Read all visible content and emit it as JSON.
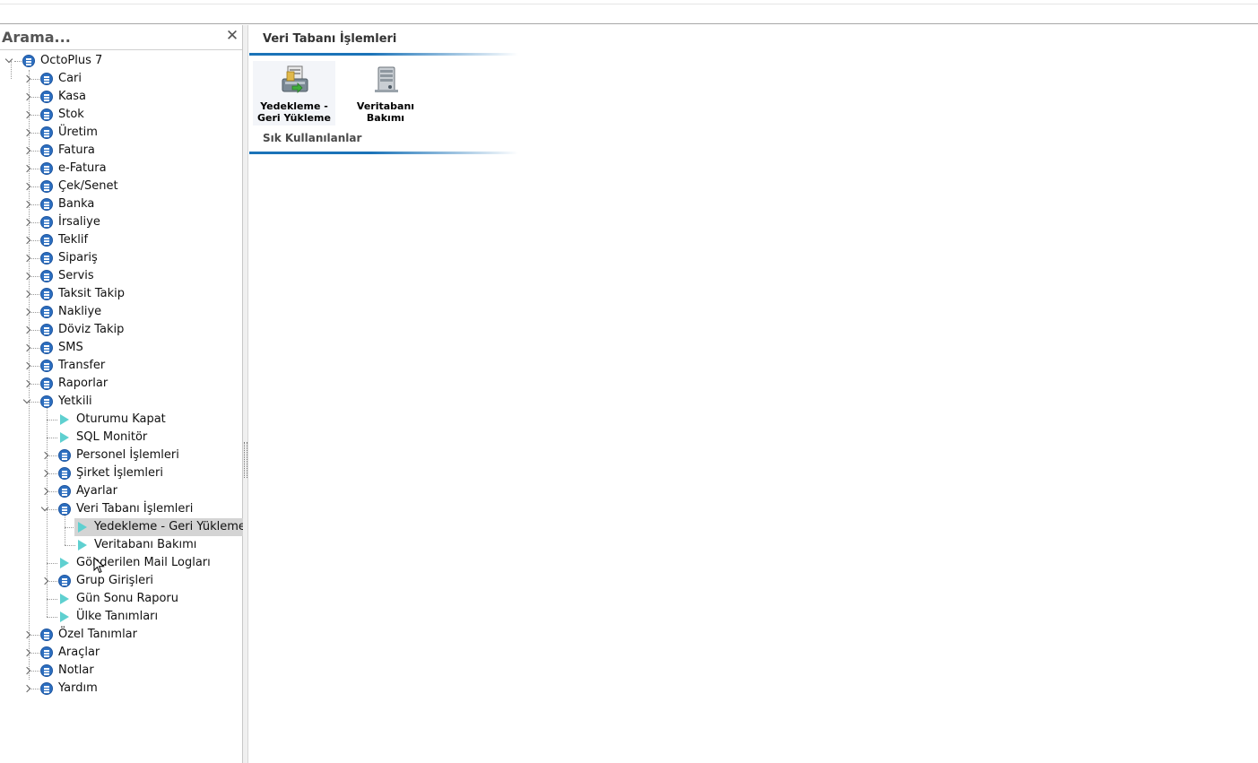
{
  "search": {
    "label": "Arama...",
    "close_glyph": "✕"
  },
  "tree": {
    "root": {
      "label": "OctoPlus 7",
      "icon": "list-circle-icon"
    },
    "items": [
      {
        "label": "Cari"
      },
      {
        "label": "Kasa"
      },
      {
        "label": "Stok"
      },
      {
        "label": "Üretim"
      },
      {
        "label": "Fatura"
      },
      {
        "label": "e-Fatura"
      },
      {
        "label": "Çek/Senet"
      },
      {
        "label": "Banka"
      },
      {
        "label": "İrsaliye"
      },
      {
        "label": "Teklif"
      },
      {
        "label": "Sipariş"
      },
      {
        "label": "Servis"
      },
      {
        "label": "Taksit Takip"
      },
      {
        "label": "Nakliye"
      },
      {
        "label": "Döviz Takip"
      },
      {
        "label": "SMS"
      },
      {
        "label": "Transfer"
      },
      {
        "label": "Raporlar"
      },
      {
        "label": "Yetkili"
      }
    ],
    "yetkili_children": [
      {
        "label": "Oturumu Kapat"
      },
      {
        "label": "SQL Monitör"
      },
      {
        "label": "Personel İşlemleri"
      },
      {
        "label": "Şirket İşlemleri"
      },
      {
        "label": "Ayarlar"
      },
      {
        "label": "Veri Tabanı İşlemleri"
      },
      {
        "label": "Gönderilen Mail Logları"
      },
      {
        "label": "Grup Girişleri"
      },
      {
        "label": "Gün Sonu Raporu"
      },
      {
        "label": "Ülke Tanımları"
      }
    ],
    "veritabani_children": [
      {
        "label": "Yedekleme - Geri Yükleme"
      },
      {
        "label": "Veritabanı Bakımı"
      }
    ],
    "bottom_items": [
      {
        "label": "Özel Tanımlar"
      },
      {
        "label": "Araçlar"
      },
      {
        "label": "Notlar"
      },
      {
        "label": "Yardım"
      }
    ]
  },
  "main": {
    "title": "Veri Tabanı İşlemleri",
    "tiles": [
      {
        "line1": "Yedekleme -",
        "line2": "Geri Yükleme",
        "icon": "backup-restore-icon"
      },
      {
        "line1": "Veritabanı",
        "line2": "Bakımı",
        "icon": "database-maintenance-icon"
      }
    ],
    "group_label": "Sık Kullanılanlar"
  },
  "colors": {
    "accent_bar": "#1b73b8",
    "node_icon": "#2d6fc0",
    "leaf_icon": "#5fd0d0",
    "selection": "#d4d4d4"
  }
}
